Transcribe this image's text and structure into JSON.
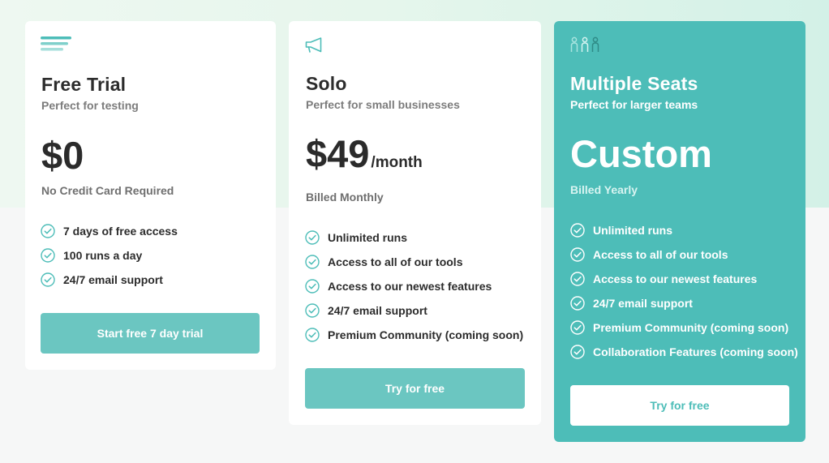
{
  "colors": {
    "accent": "#4dbdb8",
    "button": "#6bc6c1",
    "text_dark": "#2c2c2c",
    "text_muted": "#7c7c7c"
  },
  "plans": [
    {
      "icon": "menu-lines-icon",
      "title": "Free Trial",
      "subtitle": "Perfect for testing",
      "price": "$0",
      "period": "",
      "billing": "No Credit Card Required",
      "features": [
        "7 days of free access",
        "100 runs a day",
        "24/7 email support"
      ],
      "button": "Start free 7 day trial"
    },
    {
      "icon": "megaphone-icon",
      "title": "Solo",
      "subtitle": "Perfect for small businesses",
      "price": "$49",
      "period": "/month",
      "billing": "Billed Monthly",
      "features": [
        "Unlimited runs",
        "Access to all of our tools",
        "Access to our newest features",
        "24/7 email support",
        "Premium Community (coming soon)"
      ],
      "button": "Try for free"
    },
    {
      "icon": "team-icon",
      "title": "Multiple Seats",
      "subtitle": "Perfect for larger teams",
      "price": "Custom",
      "period": "",
      "billing": "Billed Yearly",
      "features": [
        "Unlimited runs",
        "Access to all of our tools",
        "Access to our newest features",
        "24/7 email support",
        "Premium Community (coming soon)",
        "Collaboration Features (coming soon)"
      ],
      "button": "Try for free"
    }
  ]
}
